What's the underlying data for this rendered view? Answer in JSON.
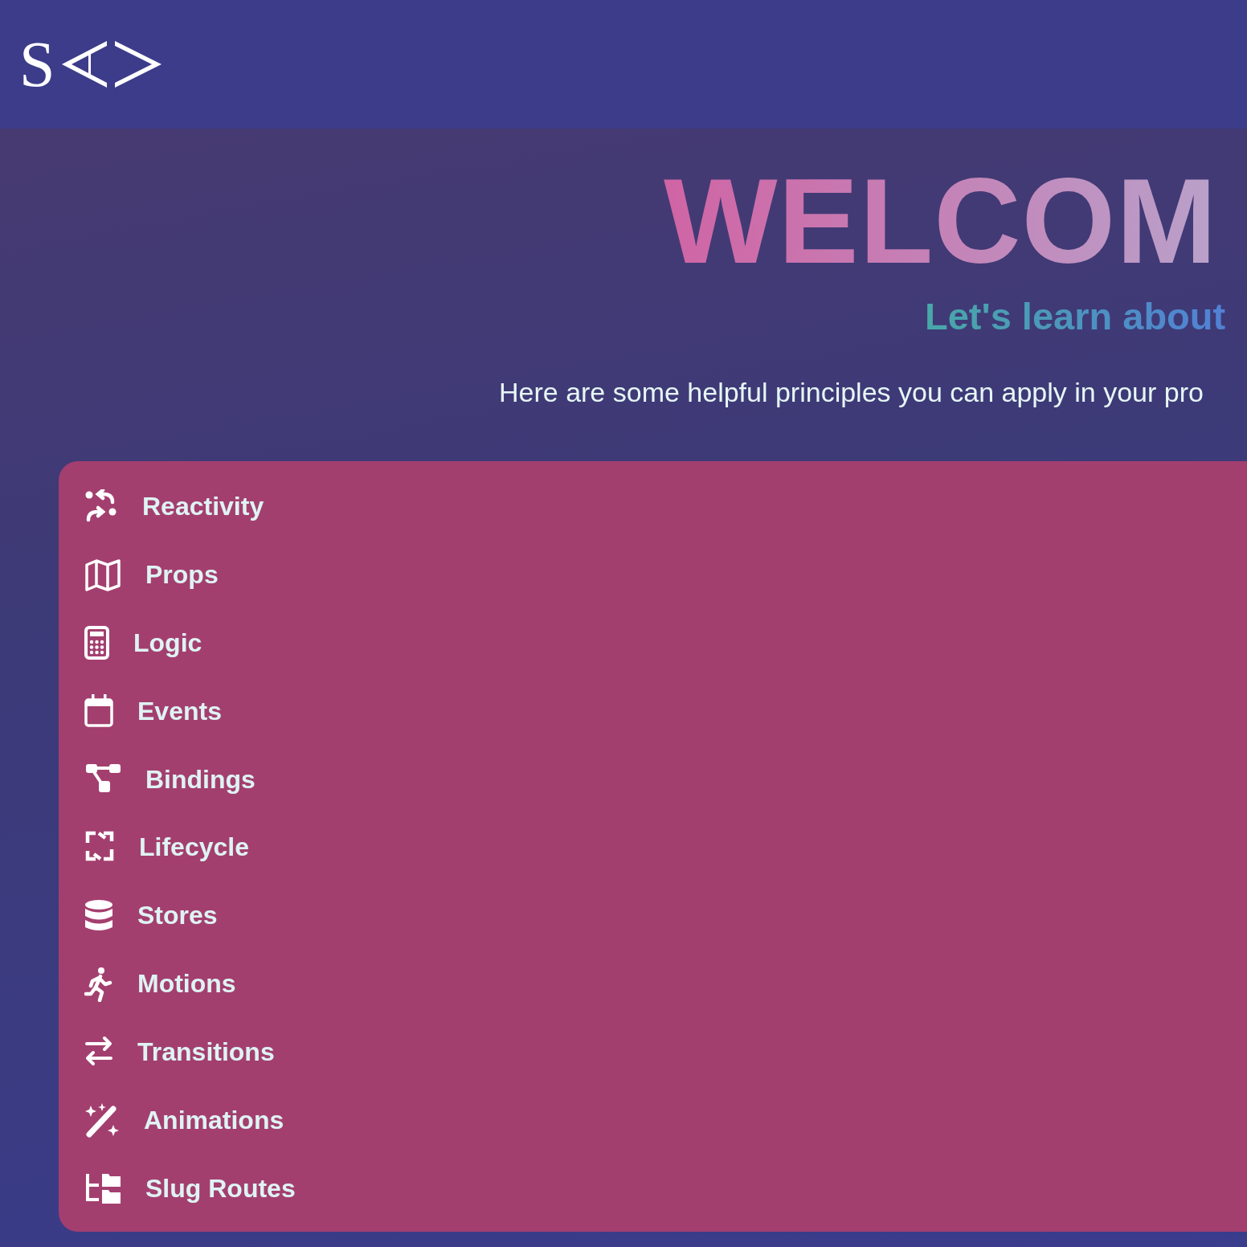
{
  "header": {
    "logo": "S"
  },
  "hero": {
    "title": "WELCOM",
    "subtitle": "Let's learn about",
    "intro": "Here are some helpful principles you can apply in your pro"
  },
  "menu": [
    {
      "label": "Reactivity",
      "kind": "shuffle"
    },
    {
      "label": "Props",
      "kind": "map"
    },
    {
      "label": "Logic",
      "kind": "calculator"
    },
    {
      "label": "Events",
      "kind": "calendar"
    },
    {
      "label": "Bindings",
      "kind": "nodes"
    },
    {
      "label": "Lifecycle",
      "kind": "cycle"
    },
    {
      "label": "Stores",
      "kind": "database"
    },
    {
      "label": "Motions",
      "kind": "runner"
    },
    {
      "label": "Transitions",
      "kind": "swap"
    },
    {
      "label": "Animations",
      "kind": "wand"
    },
    {
      "label": "Slug Routes",
      "kind": "tree"
    }
  ]
}
